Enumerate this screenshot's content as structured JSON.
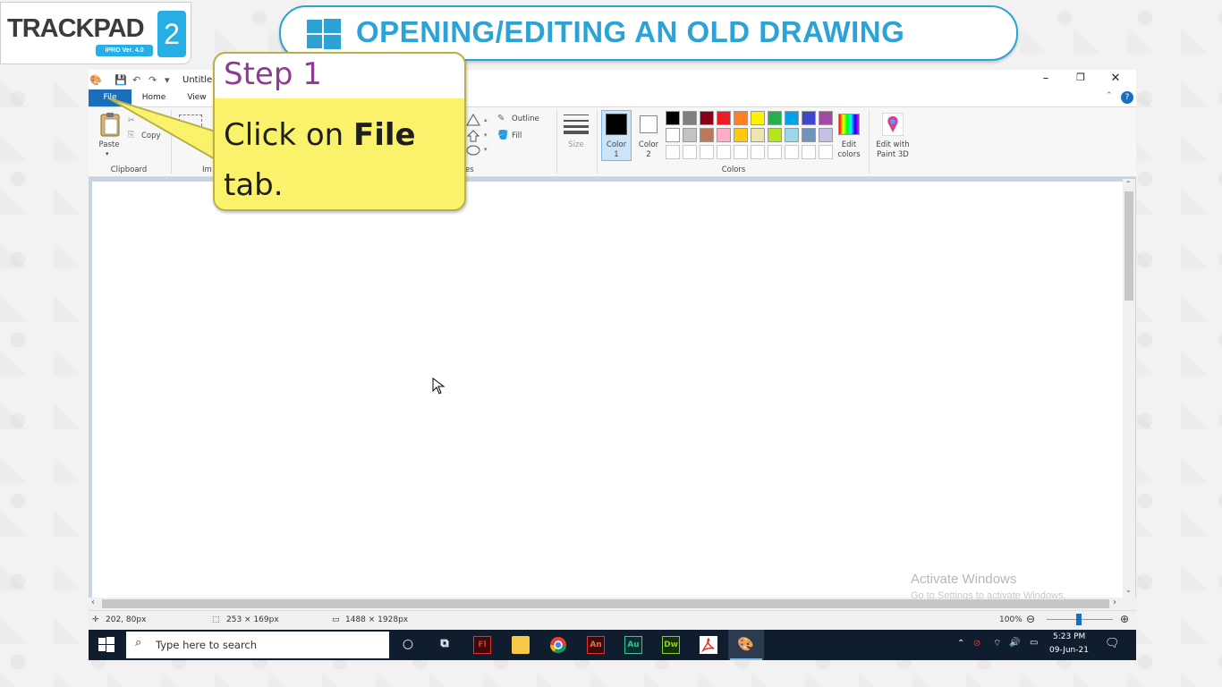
{
  "logo": {
    "text": "TRACKPAD",
    "badge": "iPRO Ver. 4.0",
    "number": "2"
  },
  "banner": {
    "title": "OPENING/EDITING AN OLD DRAWING"
  },
  "window": {
    "title": "Untitled",
    "minimize": "–",
    "restore": "❐",
    "close": "✕",
    "help": "?"
  },
  "tabs": {
    "file": "File",
    "home": "Home",
    "view": "View"
  },
  "ribbon": {
    "paste": "Paste",
    "copy": "Copy",
    "clipboard": "Clipboard",
    "image_partial": "Im",
    "shapes_partial": "es",
    "outline": "Outline",
    "fill": "Fill",
    "size": "Size",
    "color1": "Color",
    "color1_num": "1",
    "color2": "Color",
    "color2_num": "2",
    "colors": "Colors",
    "edit_colors": "Edit colors",
    "edit_paint3d": "Edit with Paint 3D"
  },
  "palette": [
    "#000000",
    "#7f7f7f",
    "#880015",
    "#ed1c24",
    "#ff7f27",
    "#fff200",
    "#22b14c",
    "#00a2e8",
    "#3f48cc",
    "#a349a4",
    "#ffffff",
    "#c3c3c3",
    "#b97a57",
    "#ffaec9",
    "#ffc90e",
    "#efe4b0",
    "#b5e61d",
    "#99d9ea",
    "#7092be",
    "#c8bfe7"
  ],
  "canvas": {
    "watermark_title": "Activate Windows",
    "watermark_sub": "Go to Settings to activate Windows."
  },
  "status": {
    "position": "202, 80px",
    "selection": "253 × 169px",
    "canvas_size": "1488 × 1928px",
    "zoom": "100%"
  },
  "taskbar": {
    "search_placeholder": "Type here to search",
    "time": "5:23 PM",
    "date": "09-Jun-21",
    "apps": [
      "Fl",
      "An",
      "Au",
      "Dw"
    ]
  },
  "callout": {
    "step": "Step 1",
    "text_before": "Click on ",
    "text_bold": "File",
    "text_after": "tab."
  }
}
